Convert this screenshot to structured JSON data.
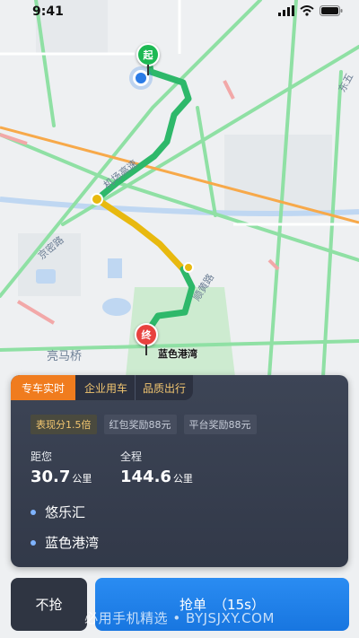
{
  "status_bar": {
    "time": "9:41"
  },
  "map": {
    "labels": [
      "东五",
      "机场高速",
      "顺黄路",
      "京密路",
      "亮马桥"
    ],
    "markers": {
      "start": "起",
      "end": "终"
    },
    "destination_label": "蓝色港湾"
  },
  "order_card": {
    "tabs": [
      {
        "label": "专车实时"
      },
      {
        "label": "企业用车"
      },
      {
        "label": "品质出行"
      }
    ],
    "badges": [
      "表现分1.5倍",
      "红包奖励88元",
      "平台奖励88元"
    ],
    "distance": {
      "label": "距您",
      "value": "30.7",
      "unit": "公里"
    },
    "total": {
      "label": "全程",
      "value": "144.6",
      "unit": "公里"
    },
    "addresses": [
      "悠乐汇",
      "蓝色港湾"
    ]
  },
  "actions": {
    "skip_label": "不抢",
    "grab_label": "抢单",
    "grab_countdown": "（15s）"
  },
  "watermark": "必用手机精选 • BYJSJXY.COM",
  "colors": {
    "accent_orange": "#f07c1e",
    "primary_blue": "#1f80ea",
    "route_green": "#2eb86a",
    "route_yellow": "#e8b90f"
  }
}
